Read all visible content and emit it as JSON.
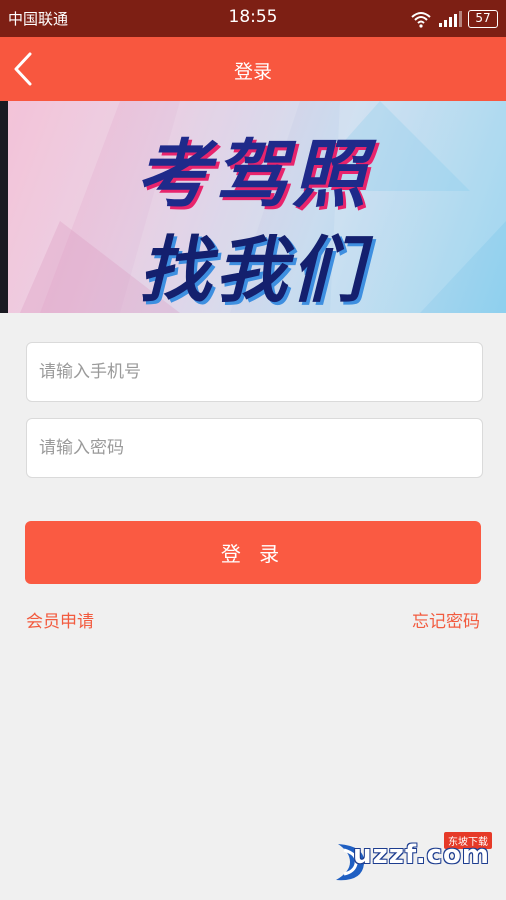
{
  "status_bar": {
    "carrier": "中国联通",
    "time": "18:55",
    "battery": "57",
    "icons": [
      "wifi-icon",
      "signal-icon",
      "battery-icon"
    ]
  },
  "navbar": {
    "title": "登录",
    "back_icon": "chevron-left-icon"
  },
  "banner": {
    "line1": "考驾照",
    "line2": "找我们"
  },
  "form": {
    "phone_placeholder": "请输入手机号",
    "phone_value": "",
    "password_placeholder": "请输入密码",
    "password_value": ""
  },
  "login_button": "登 录",
  "links": {
    "register": "会员申请",
    "forgot": "忘记密码"
  },
  "watermark": {
    "text": "uzzf.com",
    "badge": "东坡下载"
  },
  "colors": {
    "status_bar": "#7d1f14",
    "accent": "#f8573f",
    "link": "#f25b3f",
    "background": "#f0f0f0"
  }
}
